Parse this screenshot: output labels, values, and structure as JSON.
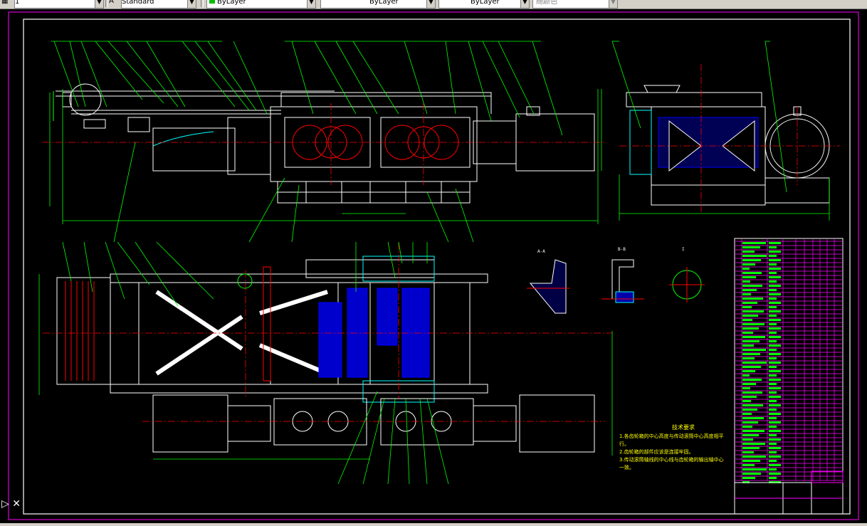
{
  "toolbar": {
    "layer_value": "1",
    "textstyle_value": "Standard",
    "color_value": "ByLayer",
    "linetype_value": "ByLayer",
    "lineweight_value": "ByLayer",
    "plotstyle_value": "随颜色"
  },
  "drawing": {
    "tech_req_title": "技术要求",
    "tech_req_lines": [
      "1.各齿轮箱的中心高度与传动滚筒中心高度相平",
      "行。",
      "2.齿轮箱的部件应该是连接牢固。",
      "3.传动滚筒轴线的中心线与齿轮箱的输出轴中心",
      "一致。"
    ],
    "section_labels": [
      "A-A",
      "B-B",
      "I"
    ]
  },
  "colors": {
    "background": "#000000",
    "frame": "#ff00ff",
    "outline": "#ffffff",
    "dimension": "#00ff00",
    "center": "#ff0000",
    "hatch": "#0000ff",
    "text": "#ffff00"
  }
}
